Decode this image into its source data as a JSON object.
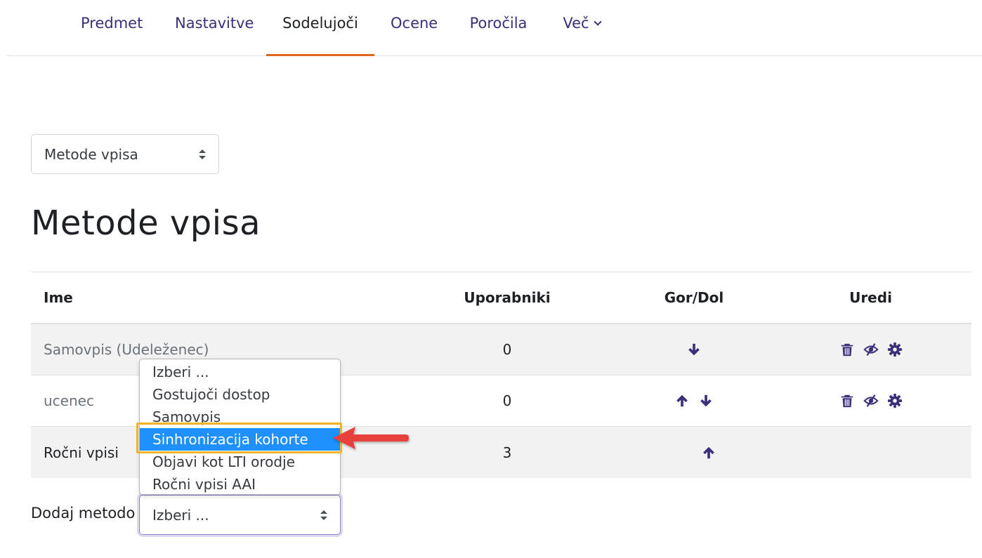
{
  "nav": {
    "tabs": [
      {
        "label": "Predmet"
      },
      {
        "label": "Nastavitve"
      },
      {
        "label": "Sodelujoči"
      },
      {
        "label": "Ocene"
      },
      {
        "label": "Poročila"
      },
      {
        "label": "Več"
      }
    ],
    "active_tab": "Sodelujoči"
  },
  "page_select": {
    "value": "Metode vpisa"
  },
  "page_title": "Metode vpisa",
  "table": {
    "headers": {
      "name": "Ime",
      "users": "Uporabniki",
      "updown": "Gor/Dol",
      "edit": "Uredi"
    },
    "rows": [
      {
        "name": "Samovpis (Udeleženec)",
        "users": "0",
        "move": [
          "arrow-down-icon"
        ],
        "edit": [
          "trash-icon",
          "eye-slash-icon",
          "gear-icon"
        ],
        "disabled": true
      },
      {
        "name": "ucenec",
        "users": "0",
        "move": [
          "arrow-up-icon",
          "arrow-down-icon"
        ],
        "edit": [
          "trash-icon",
          "eye-slash-icon",
          "gear-icon"
        ],
        "disabled": true
      },
      {
        "name": "Ročni vpisi",
        "users": "3",
        "move": [
          "arrow-up-icon"
        ],
        "edit": [],
        "disabled": false
      }
    ]
  },
  "add_method": {
    "label": "Dodaj metodo",
    "value": "Izberi ...",
    "options": [
      "Izberi ...",
      "Gostujoči dostop",
      "Samovpis",
      "Sinhronizacija kohorte",
      "Objavi kot LTI orodje",
      "Ročni vpisi AAI"
    ],
    "highlighted": "Sinhronizacija kohorte"
  },
  "colors": {
    "accent": "#3d2e7a",
    "active_tab_underline": "#e0661a",
    "option_highlight": "#1e90ff",
    "callout_box": "#f0b429",
    "callout_arrow": "#e8413e"
  }
}
